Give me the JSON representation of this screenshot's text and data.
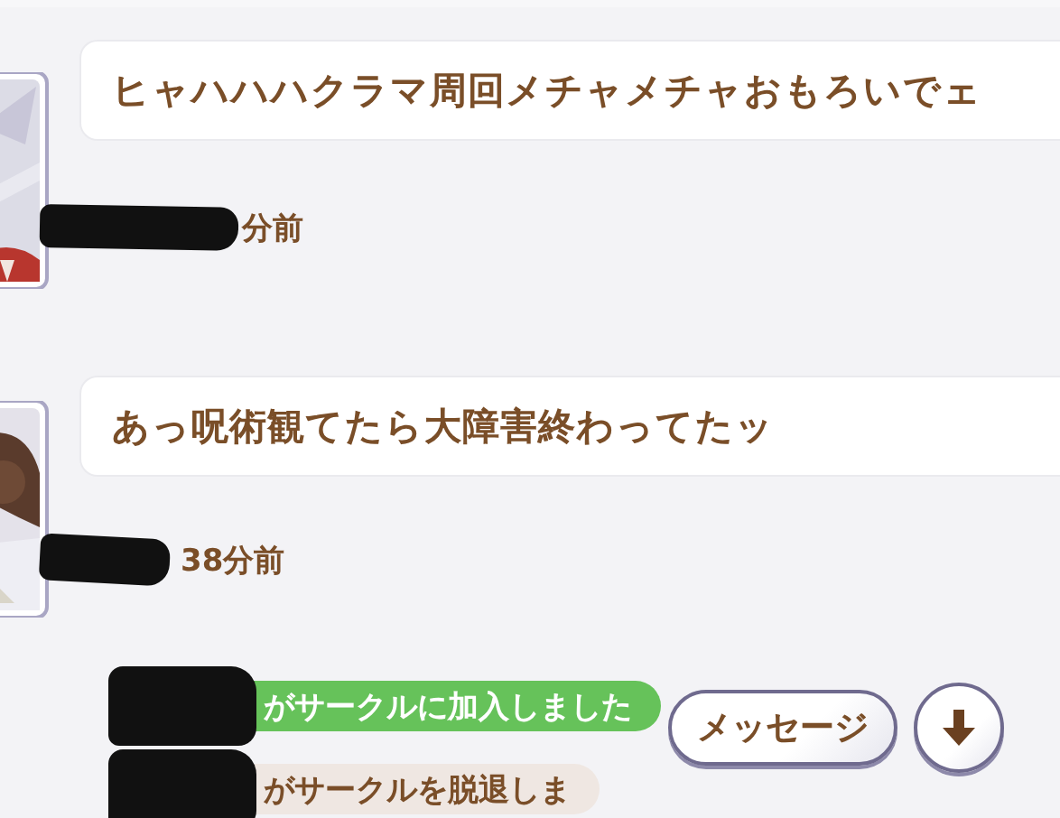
{
  "messages": [
    {
      "text": "ヒャハハハクラマ周回メチャメチャおもろいでェ",
      "time": "分前"
    },
    {
      "text": "あっ呪術観てたら大障害終わってたッ",
      "time": "38分前"
    }
  ],
  "notices": [
    {
      "kind": "join",
      "text": "がサークルに加入しました"
    },
    {
      "kind": "leave",
      "text": "がサークルを脱退しま"
    }
  ],
  "buttons": {
    "message": "メッセージ"
  }
}
